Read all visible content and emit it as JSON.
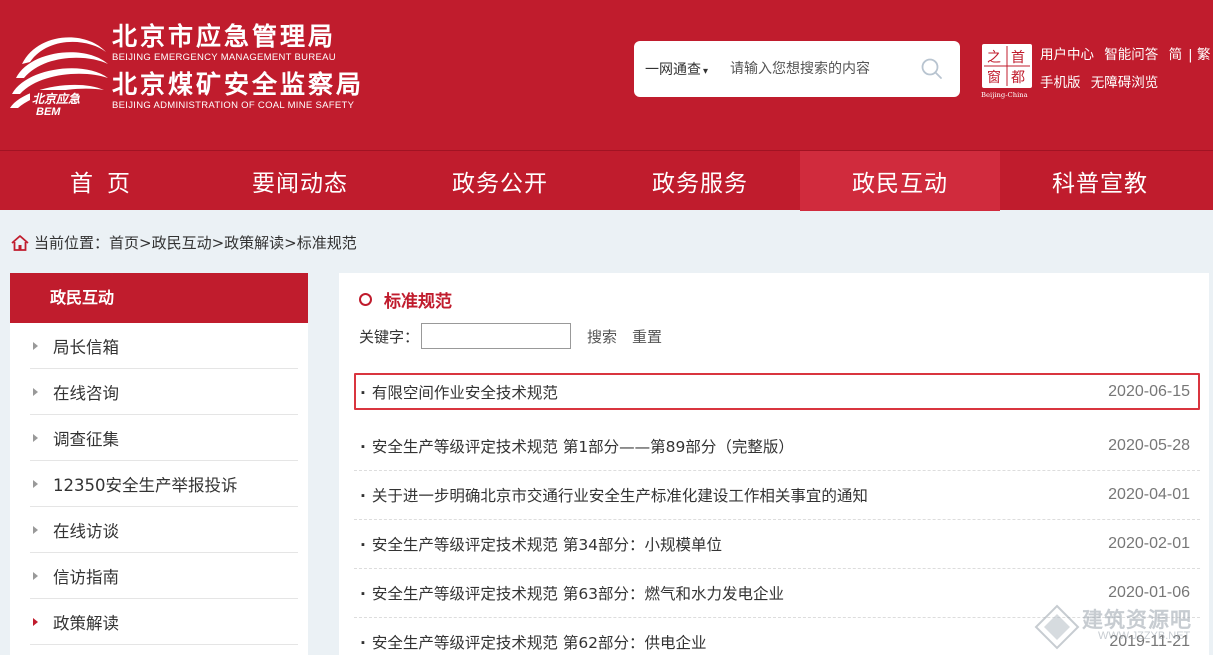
{
  "header": {
    "bureau1_cn": "北京市应急管理局",
    "bureau1_en": "BEIJING EMERGENCY MANAGEMENT BUREAU",
    "bureau2_cn": "北京煤矿安全监察局",
    "bureau2_en": "BEIJING ADMINISTRATION OF COAL MINE SAFETY",
    "search": {
      "scope": "一网通查",
      "placeholder": "请输入您想搜索的内容"
    },
    "capital_chars": [
      "之",
      "首",
      "窗",
      "都"
    ],
    "capital_en": "Beijing-China",
    "links": {
      "user_center": "用户中心",
      "smart_qa": "智能问答",
      "simplified": "简",
      "traditional": "繁",
      "mobile": "手机版",
      "accessibility": "无障碍浏览"
    },
    "colors": {
      "primary": "#c01c2d",
      "active_nav": "#d02b3d"
    }
  },
  "nav": {
    "items": [
      "首页",
      "要闻动态",
      "政务公开",
      "政务服务",
      "政民互动",
      "科普宣教"
    ],
    "active_index": 4
  },
  "breadcrumb": {
    "label": "当前位置：",
    "path": "首页>政民互动>政策解读>标准规范"
  },
  "sidebar": {
    "title": "政民互动",
    "items": [
      "局长信箱",
      "在线咨询",
      "调查征集",
      "12350安全生产举报投诉",
      "在线访谈",
      "信访指南",
      "政策解读"
    ],
    "active_index": 6
  },
  "main": {
    "title": "标准规范",
    "keyword_label": "关键字：",
    "search_btn": "搜索",
    "reset_btn": "重置",
    "items": [
      {
        "title": "有限空间作业安全技术规范",
        "date": "2020-06-15"
      },
      {
        "title": "安全生产等级评定技术规范 第1部分——第89部分（完整版）",
        "date": "2020-05-28"
      },
      {
        "title": "关于进一步明确北京市交通行业安全生产标准化建设工作相关事宜的通知",
        "date": "2020-04-01"
      },
      {
        "title": "安全生产等级评定技术规范 第34部分：小规模单位",
        "date": "2020-02-01"
      },
      {
        "title": "安全生产等级评定技术规范 第63部分：燃气和水力发电企业",
        "date": "2020-01-06"
      },
      {
        "title": "安全生产等级评定技术规范 第62部分：供电企业",
        "date": "2019-11-21"
      }
    ]
  },
  "watermark": {
    "text": "建筑资源吧",
    "sub": "WWW.JZZYB.NET"
  }
}
